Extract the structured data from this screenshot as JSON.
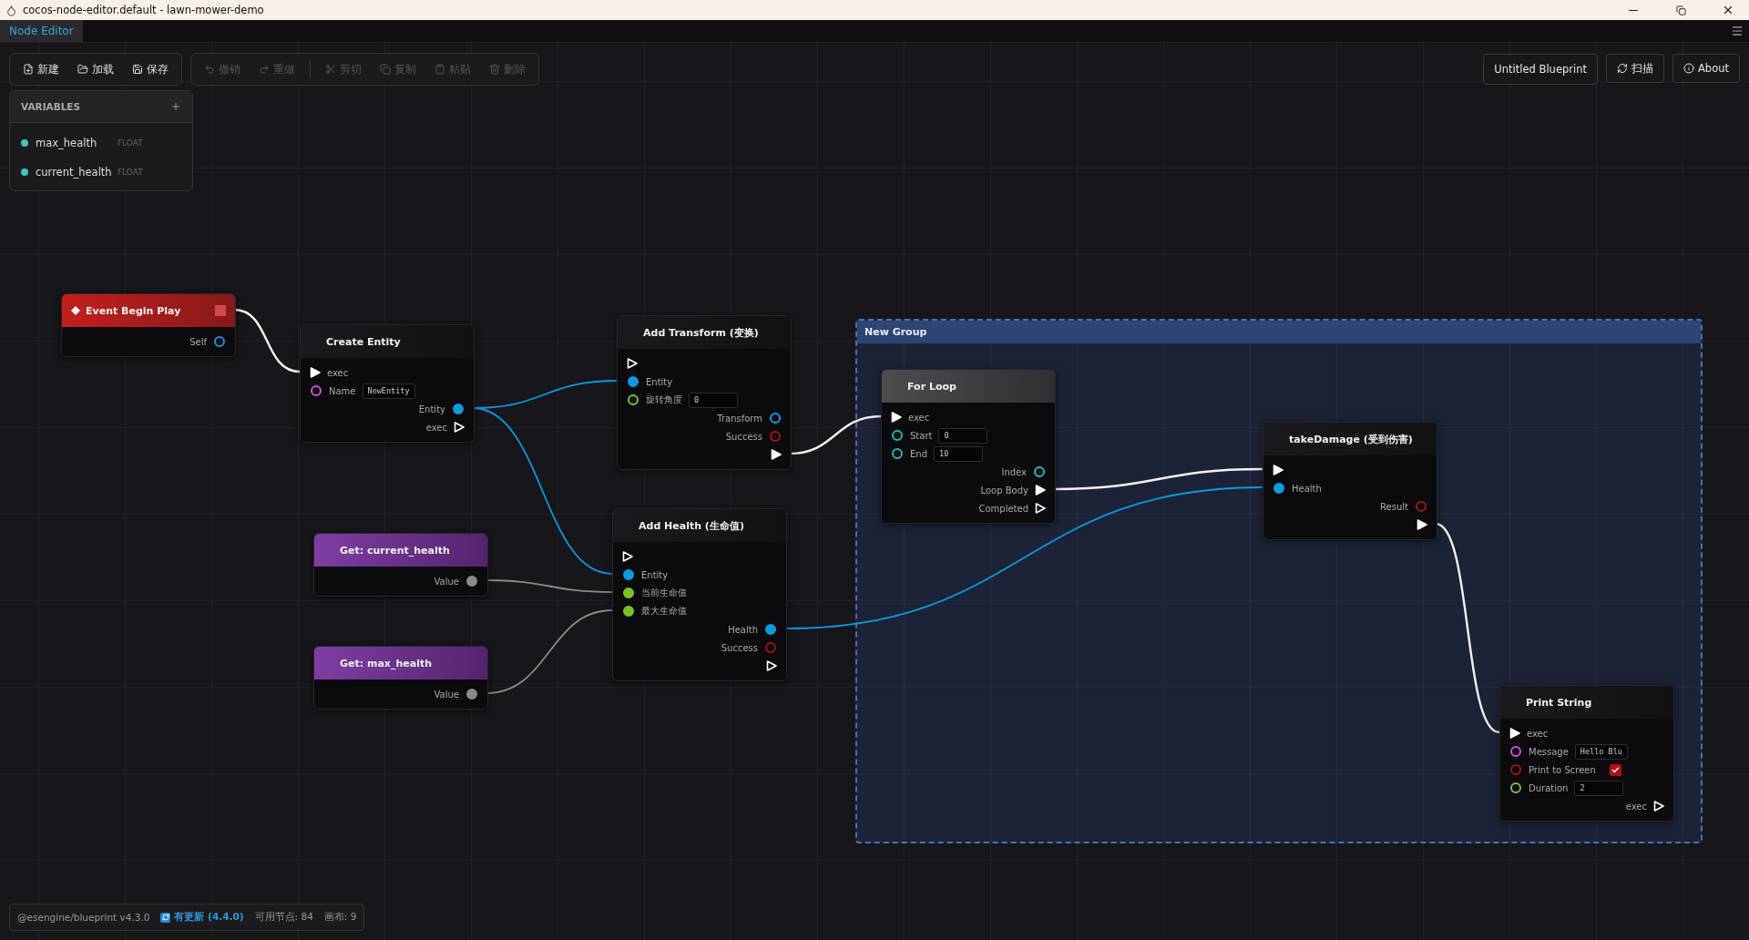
{
  "window": {
    "title": "cocos-node-editor.default - lawn-mower-demo"
  },
  "menu_tabs": [
    {
      "label": "Node Editor",
      "selected": true
    }
  ],
  "toolbar": {
    "file_actions": [
      {
        "label": "新建",
        "disabled": false
      },
      {
        "label": "加载",
        "disabled": false
      },
      {
        "label": "保存",
        "disabled": false
      }
    ],
    "edit_actions": [
      {
        "label": "撤销",
        "disabled": true
      },
      {
        "label": "重做",
        "disabled": true
      },
      {
        "label": "剪切",
        "disabled": true
      },
      {
        "label": "复制",
        "disabled": true
      },
      {
        "label": "粘贴",
        "disabled": true
      },
      {
        "label": "删除",
        "disabled": true
      }
    ]
  },
  "header_buttons": {
    "blueprint_name": "Untitled Blueprint",
    "scan": "扫描",
    "about": "About"
  },
  "variables": {
    "title": "VARIABLES",
    "items": [
      {
        "name": "max_health",
        "type": "FLOAT",
        "color": "#3cc8be"
      },
      {
        "name": "current_health",
        "type": "FLOAT",
        "color": "#3cc8be"
      }
    ]
  },
  "group": {
    "title": "New Group"
  },
  "nodes": [
    {
      "title": "Event Begin Play",
      "kind": "event",
      "outputs": [
        {
          "kind": "data",
          "label": "Self",
          "color": "#0a9be0",
          "filled": false
        }
      ]
    },
    {
      "title": "Create Entity",
      "kind": "function",
      "inputs": [
        {
          "kind": "exec",
          "label": "exec",
          "filled": true
        },
        {
          "kind": "data",
          "label": "Name",
          "color": "#d04ee0",
          "filled": false,
          "value": "NewEntity"
        }
      ],
      "outputs": [
        {
          "kind": "data",
          "label": "Entity",
          "color": "#0a9be0",
          "filled": true
        },
        {
          "kind": "exec",
          "label": "exec",
          "filled": false
        }
      ]
    },
    {
      "title": "Add Transform (变换)",
      "kind": "function",
      "inputs": [
        {
          "kind": "exec",
          "filled": false
        },
        {
          "kind": "data",
          "label": "Entity",
          "color": "#0a9be0",
          "filled": true
        },
        {
          "kind": "data",
          "label": "旋转角度",
          "color": "#7ac520",
          "filled": false,
          "value": "0"
        }
      ],
      "outputs": [
        {
          "kind": "data",
          "label": "Transform",
          "color": "#0a9be0",
          "filled": false
        },
        {
          "kind": "data",
          "label": "Success",
          "color": "#a01414",
          "filled": false
        },
        {
          "kind": "exec",
          "filled": true
        }
      ]
    },
    {
      "title": "Add Health (生命值)",
      "kind": "function",
      "inputs": [
        {
          "kind": "exec",
          "filled": false
        },
        {
          "kind": "data",
          "label": "Entity",
          "color": "#0a9be0",
          "filled": true
        },
        {
          "kind": "data",
          "label": "当前生命值",
          "color": "#7ac520",
          "filled": true
        },
        {
          "kind": "data",
          "label": "最大生命值",
          "color": "#7ac520",
          "filled": true
        }
      ],
      "outputs": [
        {
          "kind": "data",
          "label": "Health",
          "color": "#0a9be0",
          "filled": true
        },
        {
          "kind": "data",
          "label": "Success",
          "color": "#a01414",
          "filled": false
        },
        {
          "kind": "exec",
          "filled": false
        }
      ]
    },
    {
      "title": "Get: current_health",
      "kind": "getter",
      "outputs": [
        {
          "kind": "data",
          "label": "Value",
          "color": "#8a8a8a",
          "filled": true
        }
      ]
    },
    {
      "title": "Get: max_health",
      "kind": "getter",
      "outputs": [
        {
          "kind": "data",
          "label": "Value",
          "color": "#8a8a8a",
          "filled": true
        }
      ]
    },
    {
      "title": "For Loop",
      "kind": "flow",
      "inputs": [
        {
          "kind": "exec",
          "label": "exec",
          "filled": true
        },
        {
          "kind": "data",
          "label": "Start",
          "color": "#20b8b8",
          "filled": false,
          "value": "0"
        },
        {
          "kind": "data",
          "label": "End",
          "color": "#20b8b8",
          "filled": false,
          "value": "10"
        }
      ],
      "outputs": [
        {
          "kind": "data",
          "label": "Index",
          "color": "#20b8b8",
          "filled": false
        },
        {
          "kind": "exec",
          "label": "Loop Body",
          "filled": true
        },
        {
          "kind": "exec",
          "label": "Completed",
          "filled": false
        }
      ]
    },
    {
      "title": "takeDamage (受到伤害)",
      "kind": "function",
      "inputs": [
        {
          "kind": "exec",
          "filled": true
        },
        {
          "kind": "data",
          "label": "Health",
          "color": "#0a9be0",
          "filled": true
        }
      ],
      "outputs": [
        {
          "kind": "data",
          "label": "Result",
          "color": "#a01414",
          "filled": false
        },
        {
          "kind": "exec",
          "filled": true
        }
      ]
    },
    {
      "title": "Print String",
      "kind": "function",
      "inputs": [
        {
          "kind": "exec",
          "label": "exec",
          "filled": true
        },
        {
          "kind": "data",
          "label": "Message",
          "color": "#d04ee0",
          "filled": false,
          "value": "Hello Blu"
        },
        {
          "kind": "data",
          "label": "Print to Screen",
          "color": "#a01414",
          "filled": false,
          "checked": true
        },
        {
          "kind": "data",
          "label": "Duration",
          "color": "#7ac520",
          "filled": false,
          "value": "2"
        }
      ],
      "outputs": [
        {
          "kind": "exec",
          "label": "exec",
          "filled": false
        }
      ]
    }
  ],
  "status_bar": {
    "package": "@esengine/blueprint v4.3.0",
    "update": "有更新 (4.4.0)",
    "node_count": "可用节点: 84",
    "canvas": "画布: 9"
  }
}
